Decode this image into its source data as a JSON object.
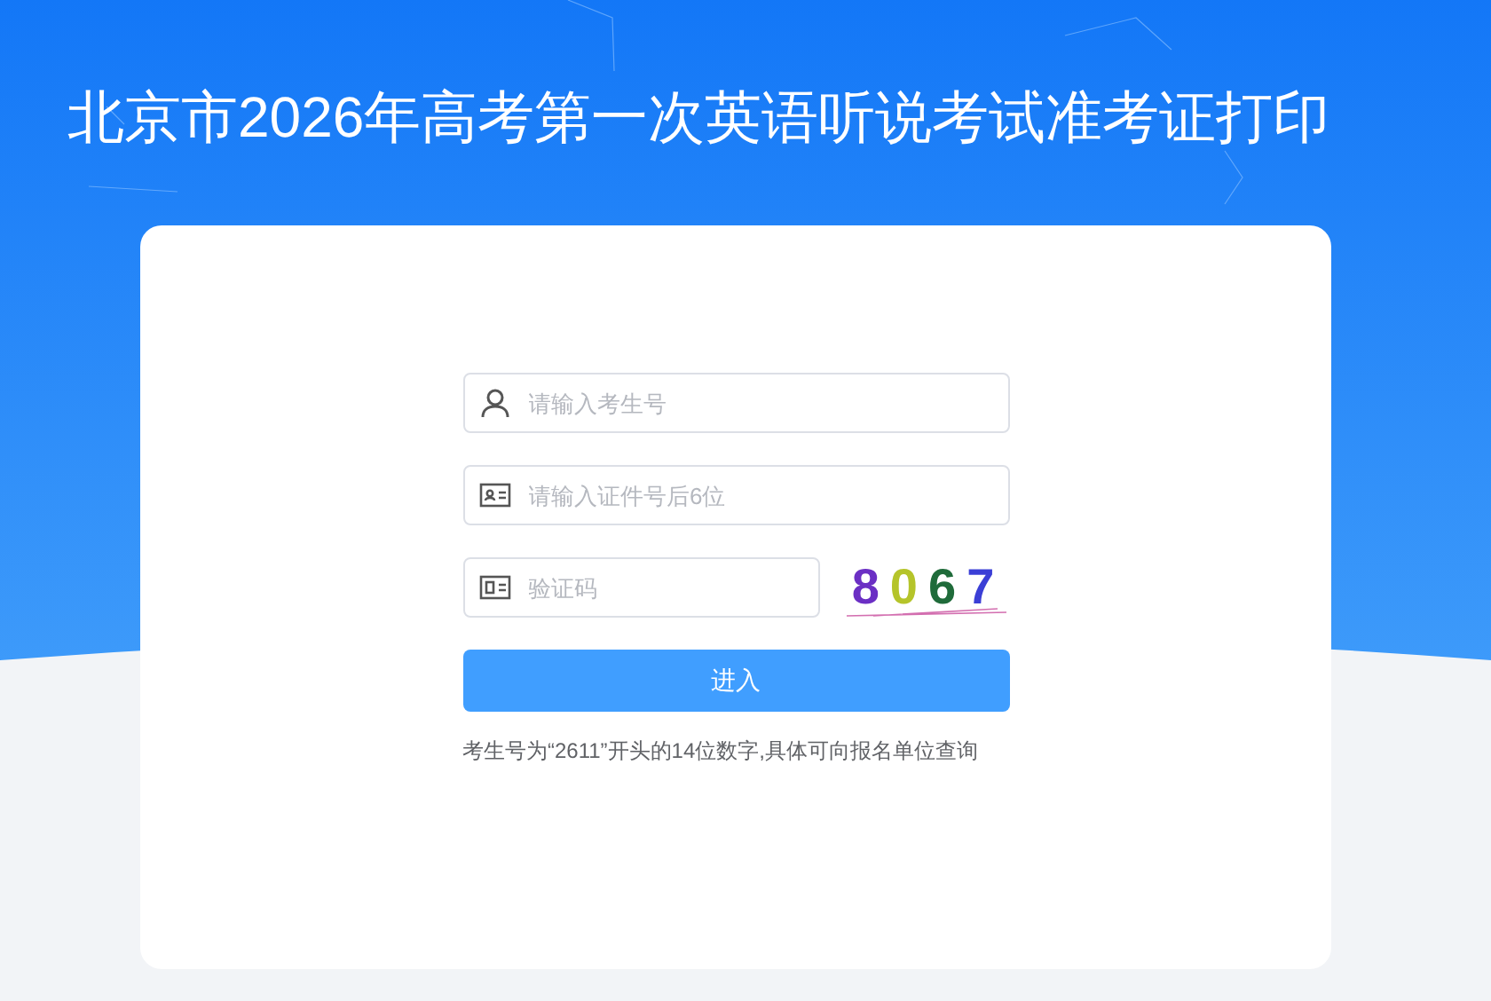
{
  "title": "北京市2026年高考第一次英语听说考试准考证打印",
  "fields": [
    {
      "kind": "user",
      "placeholder": "请输入考生号"
    },
    {
      "kind": "id",
      "placeholder": "请输入证件号后6位"
    },
    {
      "kind": "code",
      "placeholder": "验证码"
    }
  ],
  "captcha": [
    {
      "text": "8",
      "color": "#6b2fc4"
    },
    {
      "text": "0",
      "color": "#b5c42a"
    },
    {
      "text": "6",
      "color": "#1f6b3a"
    },
    {
      "text": "7",
      "color": "#3b3fd6"
    }
  ],
  "submit": "进入",
  "hint": "考生号为“2611”开头的14位数字,具体可向报名单位查询"
}
